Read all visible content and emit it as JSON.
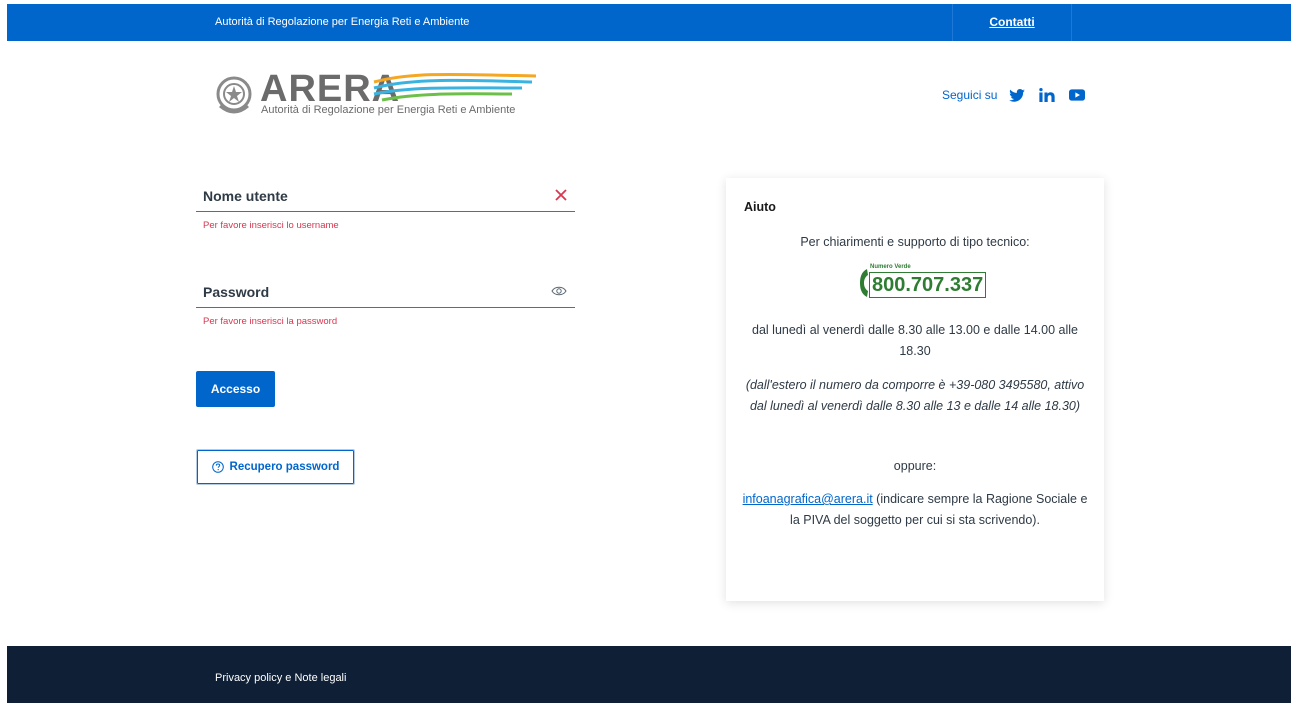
{
  "topbar": {
    "org_name": "Autorità di Regolazione per Energia Reti e Ambiente",
    "contact_label": "Contatti"
  },
  "logo": {
    "name": "ARERA",
    "subtitle": "Autorità di Regolazione per Energia Reti e Ambiente"
  },
  "social": {
    "label": "Seguici su",
    "icons": [
      "twitter-icon",
      "linkedin-icon",
      "youtube-icon"
    ]
  },
  "form": {
    "username_label": "Nome utente",
    "username_error": "Per favore inserisci lo username",
    "password_label": "Password",
    "password_error": "Per favore inserisci la password",
    "access_button": "Accesso",
    "recover_button": "Recupero password"
  },
  "help": {
    "title": "Aiuto",
    "support_text": "Per chiarimenti e supporto di tipo tecnico:",
    "numero_verde_tag": "Numero Verde",
    "phone": "800.707.337",
    "hours": "dal lunedì al venerdì dalle 8.30 alle 13.00 e dalle 14.00 alle 18.30",
    "international": "(dall'estero il numero da comporre è +39-080 3495580, attivo dal lunedì al venerdì dalle 8.30 alle 13 e dalle 14 alle 18.30)",
    "or": "oppure:",
    "email": "infoanagrafica@arera.it",
    "email_note": " (indicare sempre la Ragione Sociale e la PIVA del soggetto per cui si sta scrivendo)."
  },
  "footer": {
    "privacy": "Privacy policy e Note legali"
  },
  "colors": {
    "primary": "#0066cc",
    "error": "#d9364f",
    "footer": "#0e1f36",
    "numero_verde": "#2e7d32"
  }
}
